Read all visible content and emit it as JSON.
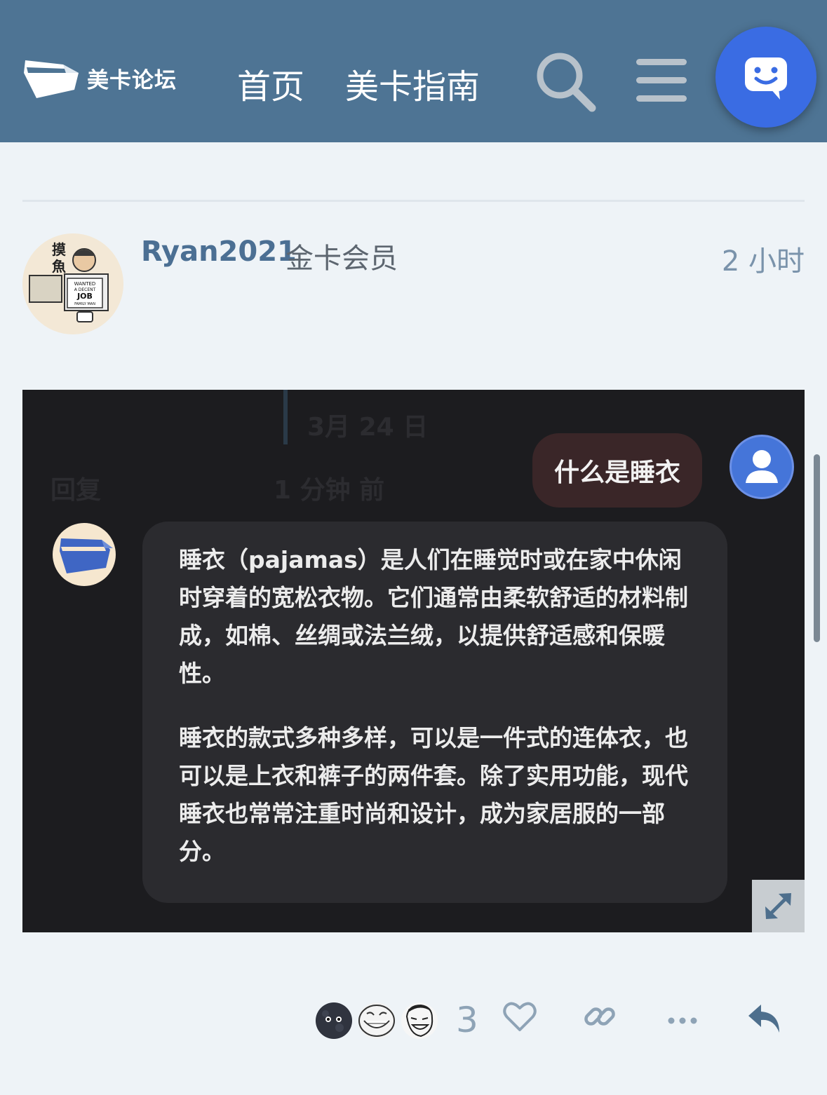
{
  "header": {
    "logo_text": "美卡论坛",
    "nav": [
      "首页",
      "美卡指南"
    ],
    "icons": [
      "search-icon",
      "hamburger-menu-icon",
      "chat-icon"
    ]
  },
  "post": {
    "username": "Ryan2021",
    "user_title": "金卡会员",
    "time": "2 小时",
    "avatar_text": {
      "line1": "摸",
      "line2": "魚",
      "sign": [
        "WANTED",
        "A DECENT",
        "JOB",
        "FAMILY MAN"
      ]
    }
  },
  "screenshot": {
    "faded": {
      "top": "3月 24 日",
      "reply": "回复",
      "time": "1 分钟 前"
    },
    "user_message": "什么是睡衣",
    "bot_paragraphs": [
      "睡衣（pajamas）是人们在睡觉时或在家中休闲时穿着的宽松衣物。它们通常由柔软舒适的材料制成，如棉、丝绸或法兰绒，以提供舒适感和保暖性。",
      "睡衣的款式多种多样，可以是一件式的连体衣，也可以是上衣和裤子的两件套。除了实用功能，现代睡衣也常常注重时尚和设计，成为家居服的一部分。"
    ]
  },
  "actions": {
    "reaction_count": "3",
    "reactions": [
      "new-moon-face",
      "trollface",
      "laughing-face"
    ],
    "icons": [
      "heart-icon",
      "link-icon",
      "more-icon",
      "reply-icon"
    ]
  },
  "colors": {
    "header": "#4e7494",
    "accent": "#3a6ce3",
    "username": "#4b6f93"
  }
}
